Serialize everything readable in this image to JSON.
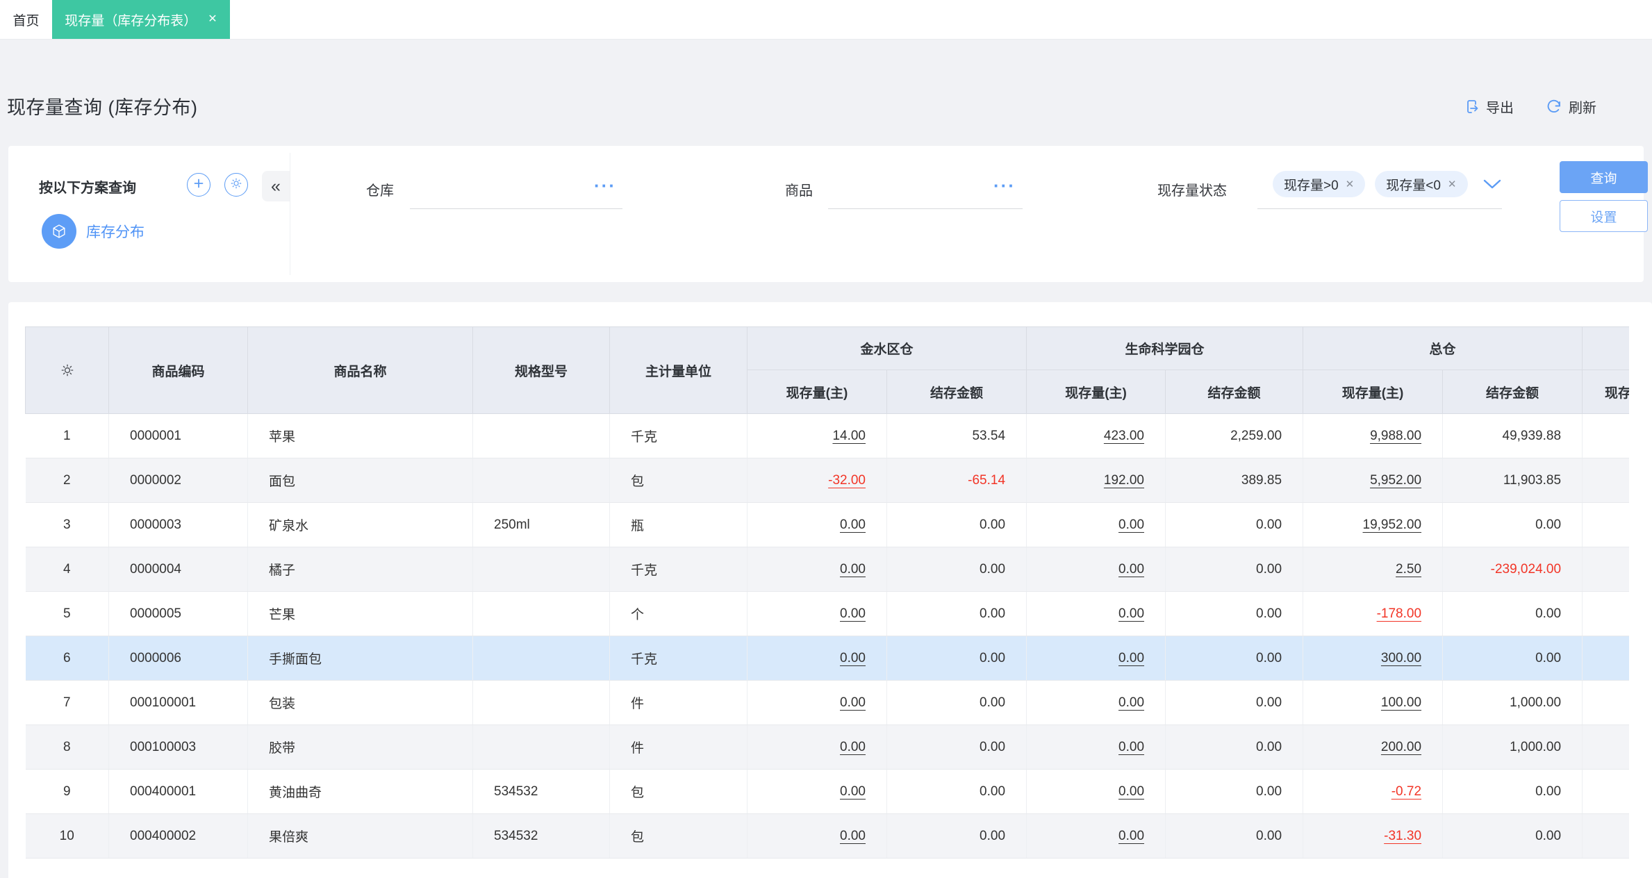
{
  "tab_bar": {
    "home_tab": "首页",
    "active_tab": "现存量（库存分布表）",
    "close_icon": "✕"
  },
  "title_bar": {
    "title": "现存量查询 (库存分布)",
    "export_label": "导出",
    "refresh_label": "刷新"
  },
  "filter": {
    "scheme_header": "按以下方案查询",
    "collapse_icon": "«",
    "scheme_item": "库存分布",
    "warehouse": {
      "label": "仓库",
      "value": "",
      "more_icon": "···"
    },
    "product": {
      "label": "商品",
      "value": "",
      "more_icon": "···"
    },
    "status": {
      "label": "现存量状态",
      "tags": [
        "现存量>0",
        "现存量<0"
      ],
      "remove_icon": "✕"
    },
    "query_button": "查询",
    "settings_button": "设置"
  },
  "table": {
    "columns": {
      "code": "商品编码",
      "name": "商品名称",
      "spec": "规格型号",
      "unit": "主计量单位"
    },
    "groups": [
      "金水区仓",
      "生命科学园仓",
      "总仓",
      ""
    ],
    "sub": {
      "qty": "现存量(主)",
      "amount": "结存金额"
    },
    "rows": [
      {
        "no": "1",
        "code": "0000001",
        "name": "苹果",
        "spec": "",
        "unit": "千克",
        "values": [
          {
            "v": "14.00",
            "link": true
          },
          {
            "v": "53.54"
          },
          {
            "v": "423.00",
            "link": true
          },
          {
            "v": "2,259.00"
          },
          {
            "v": "9,988.00",
            "link": true
          },
          {
            "v": "49,939.88"
          }
        ]
      },
      {
        "no": "2",
        "code": "0000002",
        "name": "面包",
        "spec": "",
        "unit": "包",
        "values": [
          {
            "v": "-32.00",
            "link": true,
            "neg": true
          },
          {
            "v": "-65.14",
            "neg": true
          },
          {
            "v": "192.00",
            "link": true
          },
          {
            "v": "389.85"
          },
          {
            "v": "5,952.00",
            "link": true
          },
          {
            "v": "11,903.85"
          }
        ]
      },
      {
        "no": "3",
        "code": "0000003",
        "name": "矿泉水",
        "spec": "250ml",
        "unit": "瓶",
        "values": [
          {
            "v": "0.00",
            "link": true
          },
          {
            "v": "0.00"
          },
          {
            "v": "0.00",
            "link": true
          },
          {
            "v": "0.00"
          },
          {
            "v": "19,952.00",
            "link": true
          },
          {
            "v": "0.00"
          }
        ]
      },
      {
        "no": "4",
        "code": "0000004",
        "name": "橘子",
        "spec": "",
        "unit": "千克",
        "values": [
          {
            "v": "0.00",
            "link": true
          },
          {
            "v": "0.00"
          },
          {
            "v": "0.00",
            "link": true
          },
          {
            "v": "0.00"
          },
          {
            "v": "2.50",
            "link": true
          },
          {
            "v": "-239,024.00",
            "neg": true
          }
        ]
      },
      {
        "no": "5",
        "code": "0000005",
        "name": "芒果",
        "spec": "",
        "unit": "个",
        "values": [
          {
            "v": "0.00",
            "link": true
          },
          {
            "v": "0.00"
          },
          {
            "v": "0.00",
            "link": true
          },
          {
            "v": "0.00"
          },
          {
            "v": "-178.00",
            "link": true,
            "neg": true
          },
          {
            "v": "0.00"
          }
        ]
      },
      {
        "no": "6",
        "code": "0000006",
        "name": "手撕面包",
        "spec": "",
        "unit": "千克",
        "selected": true,
        "values": [
          {
            "v": "0.00",
            "link": true
          },
          {
            "v": "0.00"
          },
          {
            "v": "0.00",
            "link": true
          },
          {
            "v": "0.00"
          },
          {
            "v": "300.00",
            "link": true
          },
          {
            "v": "0.00"
          }
        ]
      },
      {
        "no": "7",
        "code": "000100001",
        "name": "包装",
        "spec": "",
        "unit": "件",
        "values": [
          {
            "v": "0.00",
            "link": true
          },
          {
            "v": "0.00"
          },
          {
            "v": "0.00",
            "link": true
          },
          {
            "v": "0.00"
          },
          {
            "v": "100.00",
            "link": true
          },
          {
            "v": "1,000.00"
          }
        ]
      },
      {
        "no": "8",
        "code": "000100003",
        "name": "胶带",
        "spec": "",
        "unit": "件",
        "values": [
          {
            "v": "0.00",
            "link": true
          },
          {
            "v": "0.00"
          },
          {
            "v": "0.00",
            "link": true
          },
          {
            "v": "0.00"
          },
          {
            "v": "200.00",
            "link": true
          },
          {
            "v": "1,000.00"
          }
        ]
      },
      {
        "no": "9",
        "code": "000400001",
        "name": "黄油曲奇",
        "spec": "534532",
        "unit": "包",
        "values": [
          {
            "v": "0.00",
            "link": true
          },
          {
            "v": "0.00"
          },
          {
            "v": "0.00",
            "link": true
          },
          {
            "v": "0.00"
          },
          {
            "v": "-0.72",
            "link": true,
            "neg": true
          },
          {
            "v": "0.00"
          }
        ]
      },
      {
        "no": "10",
        "code": "000400002",
        "name": "果倍爽",
        "spec": "534532",
        "unit": "包",
        "values": [
          {
            "v": "0.00",
            "link": true
          },
          {
            "v": "0.00"
          },
          {
            "v": "0.00",
            "link": true
          },
          {
            "v": "0.00"
          },
          {
            "v": "-31.30",
            "link": true,
            "neg": true
          },
          {
            "v": "0.00"
          }
        ]
      }
    ]
  },
  "colors": {
    "accent_green": "#3ec7a2",
    "accent_blue": "#5c9cf5",
    "negative_red": "#f23527",
    "selected_row": "#d8e9fb",
    "header_bg": "#e9ecf3"
  }
}
